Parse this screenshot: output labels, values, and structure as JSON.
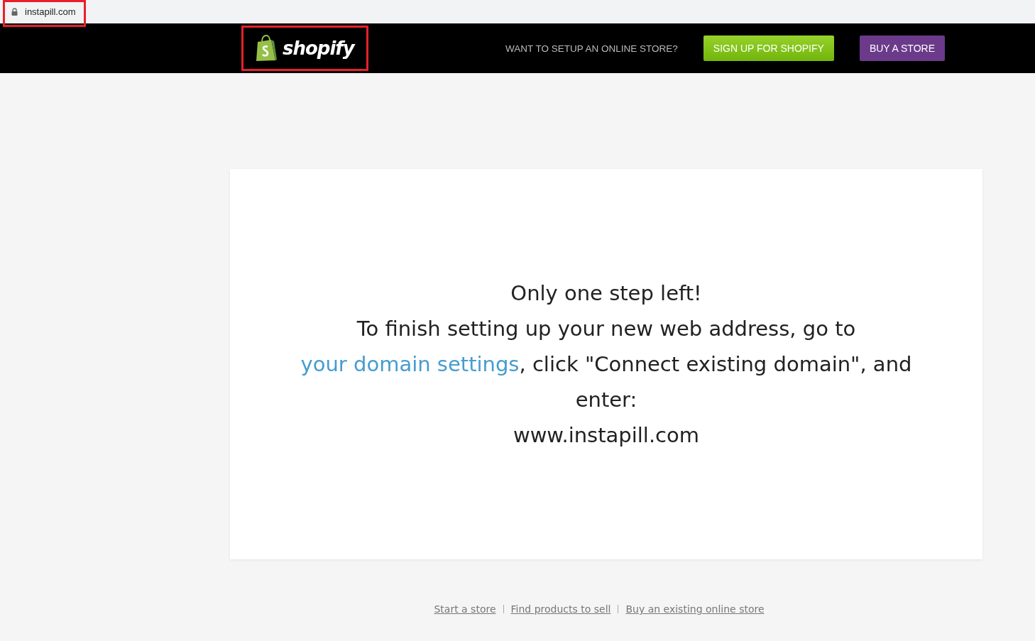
{
  "address_bar": {
    "url": "instapill.com",
    "highlighted": true
  },
  "header": {
    "logo": {
      "text": "shopify",
      "highlighted": true
    },
    "prompt": "WANT TO SETUP AN ONLINE STORE?",
    "buttons": [
      {
        "label": "SIGN UP FOR SHOPIFY",
        "kind": "signup"
      },
      {
        "label": "BUY A STORE",
        "kind": "buy"
      }
    ]
  },
  "card": {
    "heading": "Only one step left!",
    "message": {
      "before": "To finish setting up your new web address, go to ",
      "link": "your domain settings",
      "after": ", click \"Connect existing domain\", and enter:"
    },
    "domain": "www.instapill.com"
  },
  "footer_links": [
    "Start a store",
    "Find products to sell",
    "Buy an existing online store"
  ]
}
